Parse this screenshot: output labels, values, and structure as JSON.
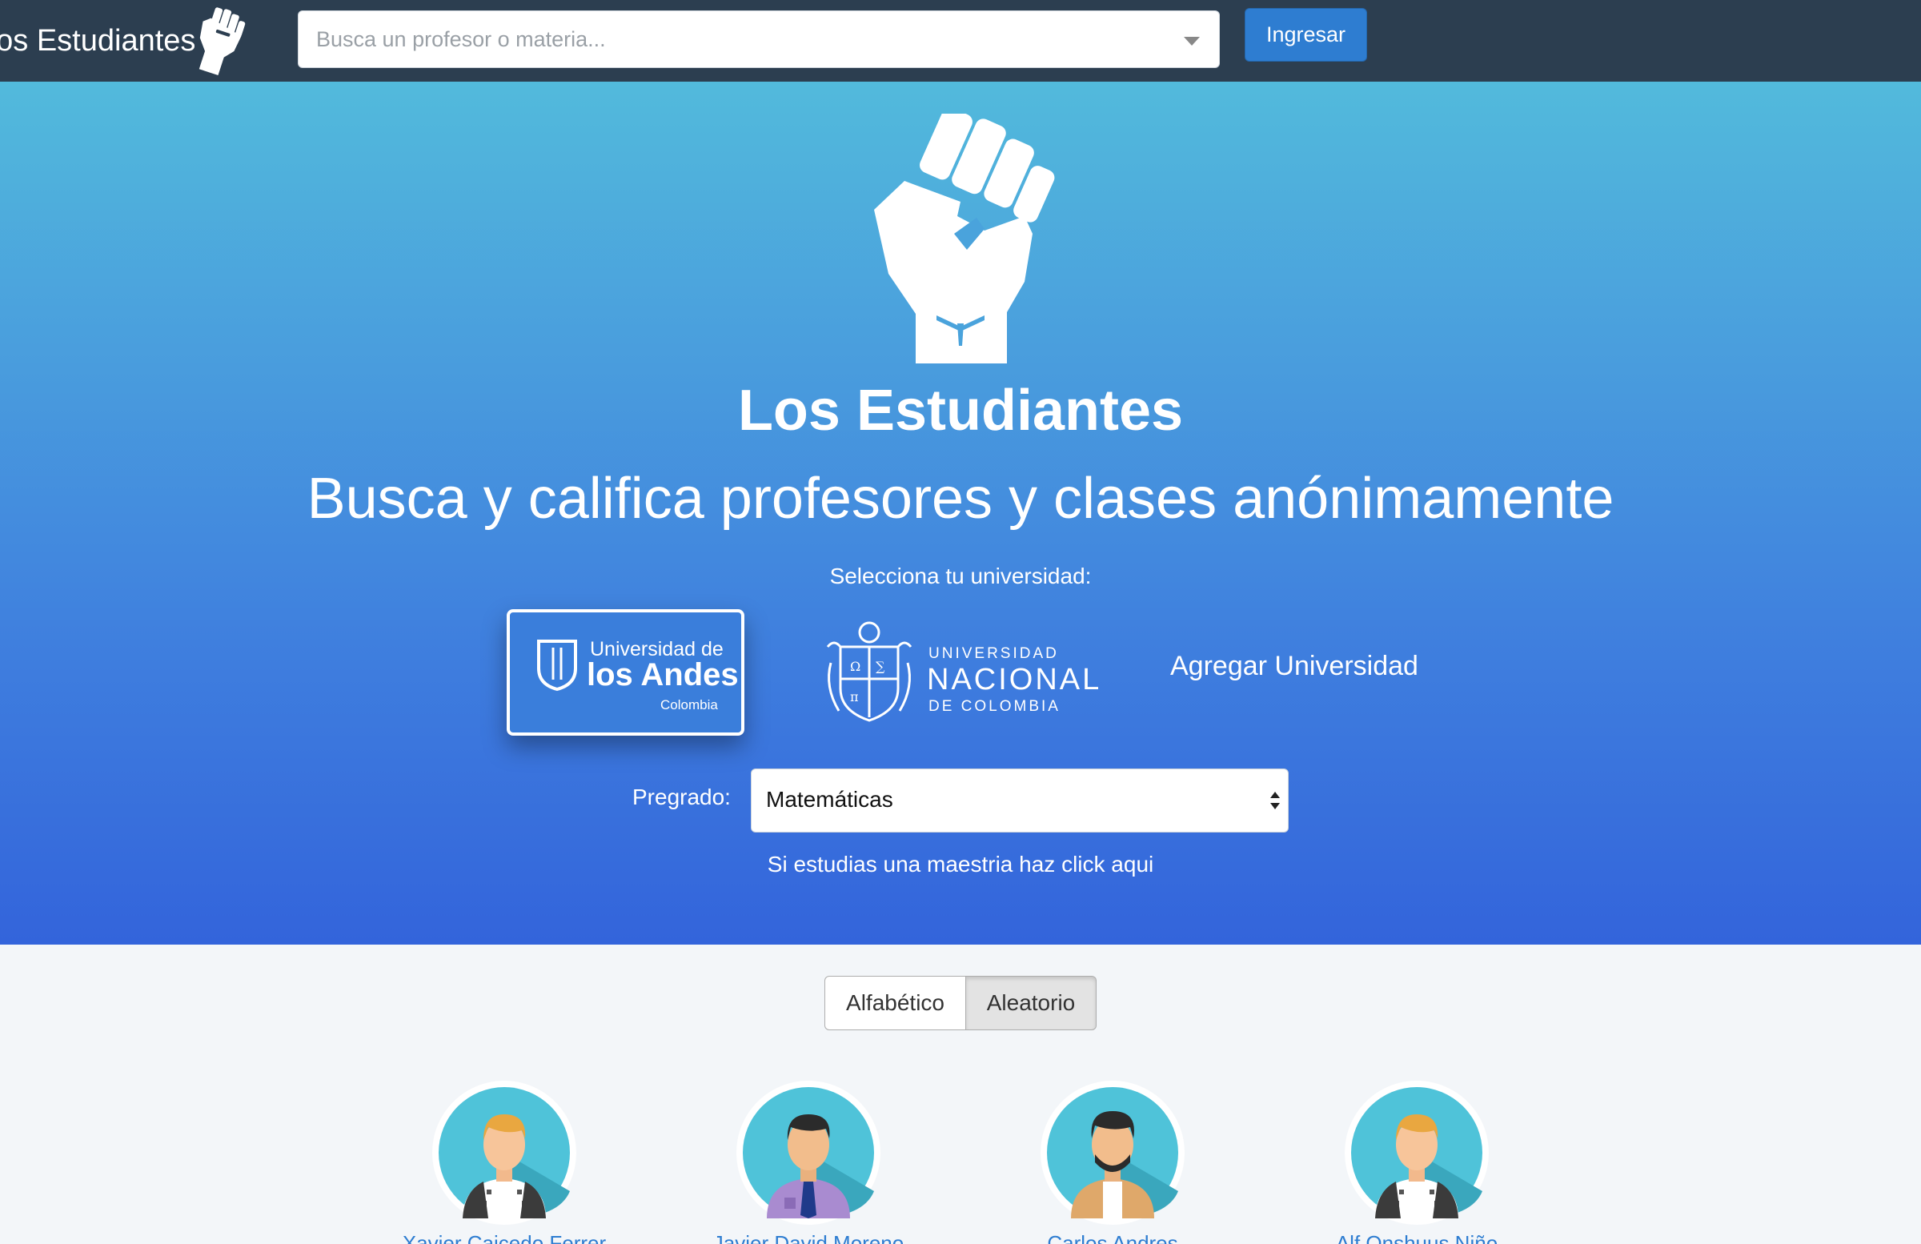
{
  "navbar": {
    "brand": "Los Estudiantes",
    "search_placeholder": "Busca un profesor o materia...",
    "login_label": "Ingresar"
  },
  "hero": {
    "title": "Los Estudiantes",
    "subtitle": "Busca y califica profesores y clases anónimamente",
    "select_label": "Selecciona tu universidad:",
    "universities": {
      "andes": {
        "line1": "Universidad de",
        "line2": "los Andes",
        "line3": "Colombia"
      },
      "nacional": {
        "line1": "UNIVERSIDAD",
        "line2": "NACIONAL",
        "line3": "DE COLOMBIA"
      }
    },
    "add_university": "Agregar Universidad",
    "pregrado_label": "Pregrado:",
    "pregrado_value": "Matemáticas",
    "maestria_link": "Si estudias una maestria haz click aqui"
  },
  "sort": {
    "options": [
      "Alfabético",
      "Aleatorio"
    ],
    "selected": "Aleatorio"
  },
  "professors": [
    {
      "name": "Xavier Caicedo Ferrer"
    },
    {
      "name": "Javier David Moreno"
    },
    {
      "name": "Carlos Andres"
    },
    {
      "name": "Alf Onshuus Niño"
    }
  ],
  "colors": {
    "navbar": "#2c3e50",
    "hero_top": "#52badc",
    "hero_bottom": "#3364db",
    "primary_button": "#2e7dd1",
    "avatar_bg": "#4fc3d9"
  }
}
